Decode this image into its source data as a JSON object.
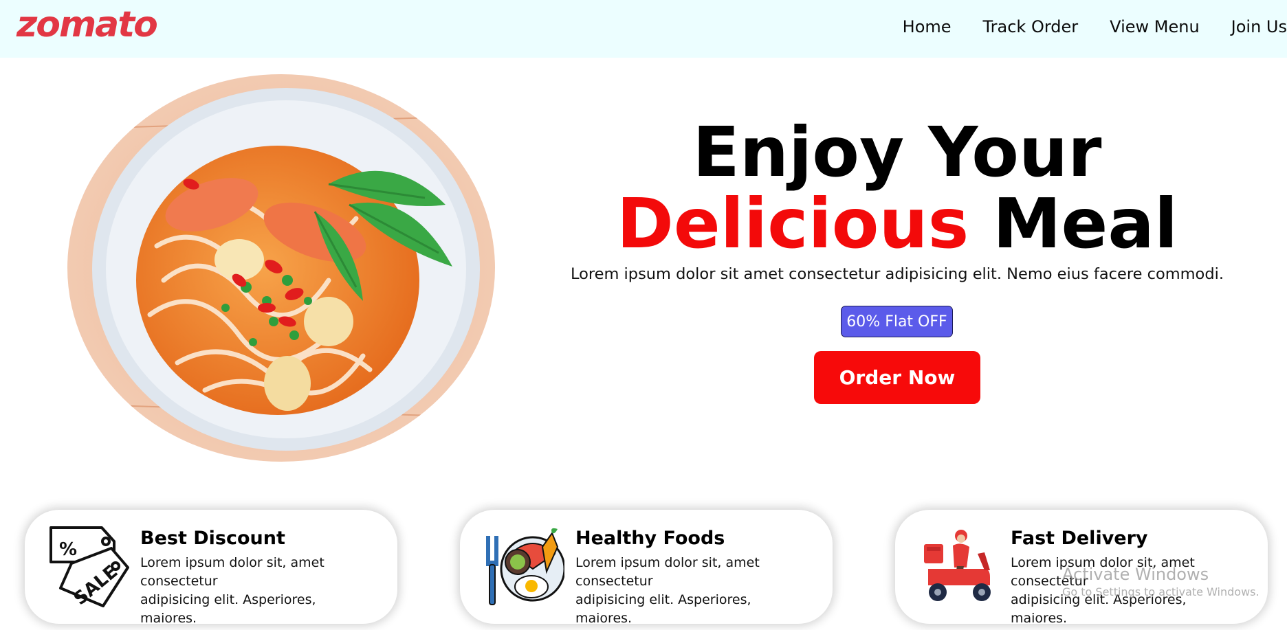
{
  "brand": {
    "logo_text": "zomato",
    "accent_color": "#e23744"
  },
  "nav": {
    "items": [
      {
        "label": "Home"
      },
      {
        "label": "Track Order"
      },
      {
        "label": "View Menu"
      },
      {
        "label": "Join Us"
      }
    ]
  },
  "hero": {
    "image_alt": "bowl of noodle soup with shrimp and herbs",
    "headline_line1": "Enjoy Your",
    "headline_accent": "Delicious",
    "headline_rest": "Meal",
    "subtitle": "Lorem ipsum dolor sit amet consectetur adipisicing elit. Nemo eius facere commodi.",
    "badge": "60% Flat OFF",
    "cta": "Order Now",
    "accent_color": "#f30a0a"
  },
  "features": [
    {
      "title": "Best Discount",
      "line1": "Lorem ipsum dolor sit, amet",
      "line2": "consectetur",
      "line3": "adipisicing elit. Asperiores, maiores.",
      "icon": "sale-tag-icon"
    },
    {
      "title": "Healthy Foods",
      "line1": "Lorem ipsum dolor sit, amet",
      "line2": "consectetur",
      "line3": "adipisicing elit. Asperiores, maiores.",
      "icon": "healthy-plate-icon"
    },
    {
      "title": "Fast Delivery",
      "line1": "Lorem ipsum dolor sit, amet",
      "line2": "consectetur",
      "line3": "adipisicing elit. Asperiores, maiores.",
      "icon": "delivery-scooter-icon"
    }
  ],
  "watermark": {
    "title": "Activate Windows",
    "subtitle": "Go to Settings to activate Windows."
  }
}
